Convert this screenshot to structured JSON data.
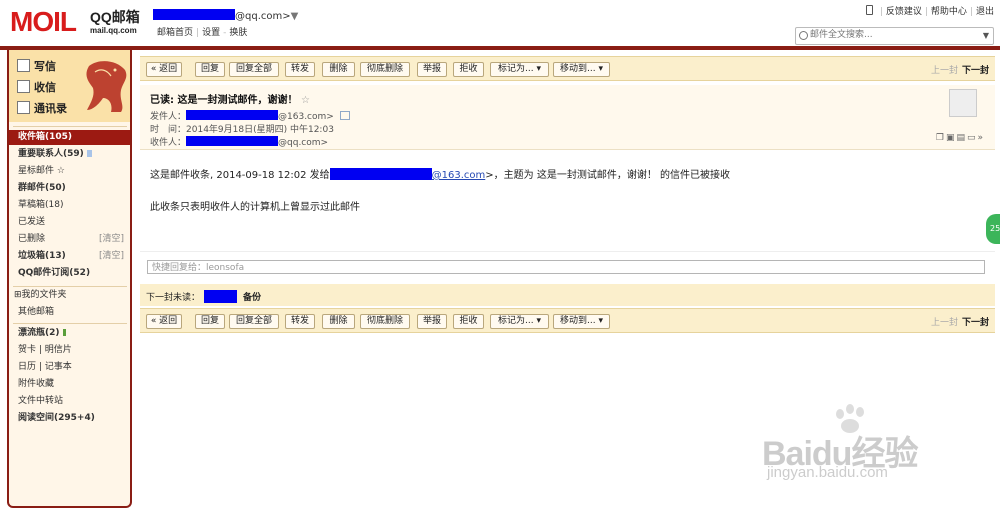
{
  "brand": {
    "logo_text": "MOIL",
    "name": "QQ邮箱",
    "domain": "mail.qq.com"
  },
  "account": {
    "email_suffix": "@qq.com>",
    "caret": "▼",
    "links": [
      "邮箱首页",
      "设置",
      "换肤"
    ]
  },
  "top_links": [
    "反馈建议",
    "帮助中心",
    "退出"
  ],
  "search": {
    "placeholder": "邮件全文搜索..."
  },
  "sidebar": {
    "quick": [
      "写信",
      "收信",
      "通讯录"
    ],
    "folders": [
      {
        "label": "收件箱(105)",
        "active": true
      },
      {
        "label": "重要联系人(59)",
        "bold": true
      },
      {
        "label": "星标邮件 ☆"
      },
      {
        "label": "群邮件(50)",
        "bold": true
      },
      {
        "label": "草稿箱(18)"
      },
      {
        "label": "已发送"
      },
      {
        "label": "已删除",
        "clear": "[清空]"
      },
      {
        "label": "垃圾箱(13)",
        "bold": true,
        "clear": "[清空]"
      },
      {
        "label": "QQ邮件订阅(52)",
        "bold": true
      }
    ],
    "my_folders": [
      "⊞我的文件夹",
      "其他邮箱"
    ],
    "apps": [
      {
        "label": "漂流瓶(2)",
        "bold": true
      },
      {
        "label": "贺卡 | 明信片"
      },
      {
        "label": "日历 | 记事本"
      },
      {
        "label": "附件收藏"
      },
      {
        "label": "文件中转站"
      },
      {
        "label": "阅读空间(295+4)",
        "bold": true
      }
    ]
  },
  "toolbar": {
    "buttons": [
      "« 返回",
      "回复",
      "回复全部",
      "转发",
      "删除",
      "彻底删除",
      "举报",
      "拒收",
      "标记为... ▾",
      "移动到... ▾"
    ],
    "prev": "上一封",
    "next": "下一封"
  },
  "message": {
    "subject": "已读: 这是一封测试邮件，谢谢！",
    "star": "☆",
    "from_label": "发件人：",
    "from_suffix": "@163.com>",
    "time_label": "时　间：",
    "time": "2014年9月18日(星期四) 中午12:03",
    "to_label": "收件人：",
    "to_suffix": "@qq.com>",
    "body_pre": "这是邮件收条, 2014-09-18 12:02 发给",
    "body_link": "@163.com",
    "body_post": ">，主题为 这是一封测试邮件，谢谢！ 的信件已被接收",
    "body_line2": "此收条只表明收件人的计算机上曾显示过此邮件"
  },
  "quick_reply": {
    "placeholder": "快捷回复给：leonsofa"
  },
  "next_unread": {
    "label": "下一封未读：",
    "suffix": "备份"
  },
  "watermark": {
    "text": "Baidu经验",
    "url": "jingyan.baidu.com"
  },
  "colors": {
    "accent_red": "#8a1d14",
    "redaction": "#0000f2",
    "toolbar_bg": "#fbefcc"
  }
}
